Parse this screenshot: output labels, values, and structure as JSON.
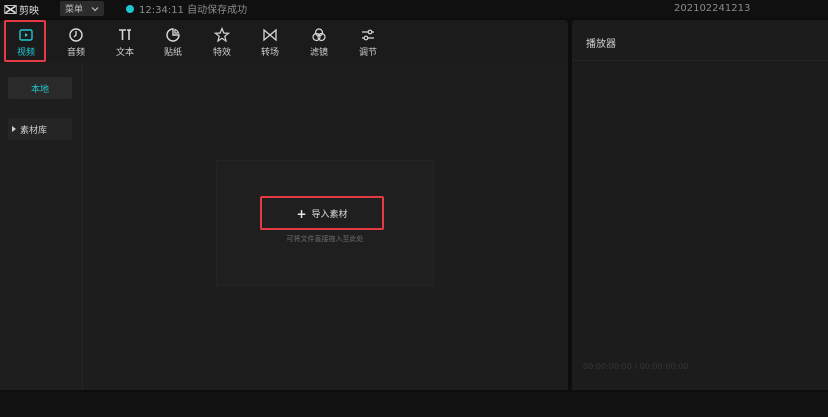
{
  "app": {
    "name": "剪映",
    "logo_icon": "capcut-logo-icon"
  },
  "titlebar": {
    "menu_label": "菜单",
    "save_status": "12:34:11 自动保存成功",
    "project_name": "202102241213",
    "accent": "#1ec6d2"
  },
  "toolbar": {
    "tools": [
      {
        "label": "视频",
        "icon": "video-icon"
      },
      {
        "label": "音频",
        "icon": "audio-icon"
      },
      {
        "label": "文本",
        "icon": "text-icon"
      },
      {
        "label": "贴纸",
        "icon": "sticker-icon"
      },
      {
        "label": "特效",
        "icon": "effects-icon"
      },
      {
        "label": "转场",
        "icon": "transition-icon"
      },
      {
        "label": "滤镜",
        "icon": "filter-icon"
      },
      {
        "label": "调节",
        "icon": "adjust-icon"
      }
    ],
    "active_index": 0
  },
  "subnav": {
    "local_label": "本地",
    "library_label": "素材库"
  },
  "media": {
    "import_label": "导入素材",
    "drop_hint": "可将文件直接拖入至此处"
  },
  "player": {
    "title": "播放器",
    "timecode": "00:00:00:00 / 00:00:00:00"
  },
  "colors": {
    "highlight": "#e23b44",
    "accent": "#20c9d2"
  }
}
